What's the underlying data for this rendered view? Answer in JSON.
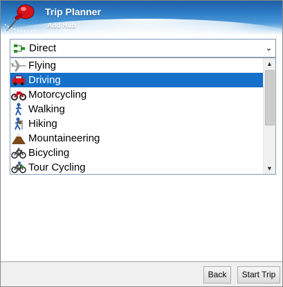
{
  "header": {
    "title": "Trip Planner",
    "subtitle": "Add Hub"
  },
  "routing_mode": {
    "selected": "Direct"
  },
  "list": {
    "items": [
      {
        "label": "Flying",
        "icon": "airplane-icon"
      },
      {
        "label": "Driving",
        "icon": "car-icon",
        "selected": true
      },
      {
        "label": "Motorcycling",
        "icon": "motorcycle-icon"
      },
      {
        "label": "Walking",
        "icon": "walking-person-icon"
      },
      {
        "label": "Hiking",
        "icon": "hiker-icon"
      },
      {
        "label": "Mountaineering",
        "icon": "mountain-icon"
      },
      {
        "label": "Bicycling",
        "icon": "bicycle-icon"
      },
      {
        "label": "Tour Cycling",
        "icon": "touring-bicycle-icon"
      }
    ]
  },
  "footer": {
    "back_label": "Back",
    "start_label": "Start Trip"
  },
  "colors": {
    "selection": "#1470c8",
    "header_dark": "#1f5fa4",
    "pin_red": "#d4141a"
  }
}
